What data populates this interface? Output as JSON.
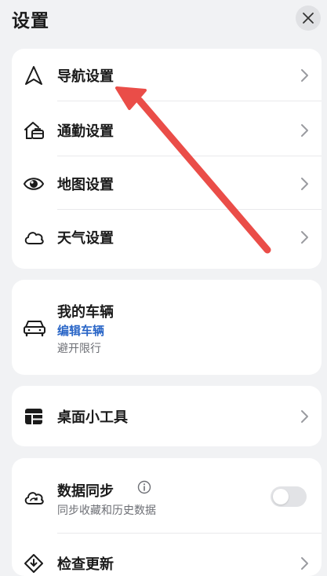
{
  "header": {
    "title": "设置"
  },
  "settings_group": {
    "items": [
      {
        "label": "导航设置",
        "icon": "navigation-arrow-icon"
      },
      {
        "label": "通勤设置",
        "icon": "home-briefcase-icon"
      },
      {
        "label": "地图设置",
        "icon": "eye-icon"
      },
      {
        "label": "天气设置",
        "icon": "cloud-icon"
      }
    ]
  },
  "vehicle": {
    "title": "我的车辆",
    "edit_label": "编辑车辆",
    "subtitle": "避开限行",
    "icon": "car-icon"
  },
  "widgets": {
    "label": "桌面小工具",
    "icon": "widgets-icon"
  },
  "sync": {
    "title": "数据同步",
    "subtitle": "同步收藏和历史数据",
    "toggle_on": false,
    "icon": "cloud-sync-icon"
  },
  "update": {
    "label": "检查更新",
    "icon": "update-icon"
  },
  "colors": {
    "accent": "#2a66c7",
    "annotation_arrow": "#ea4d48",
    "background": "#f1f2f4"
  }
}
